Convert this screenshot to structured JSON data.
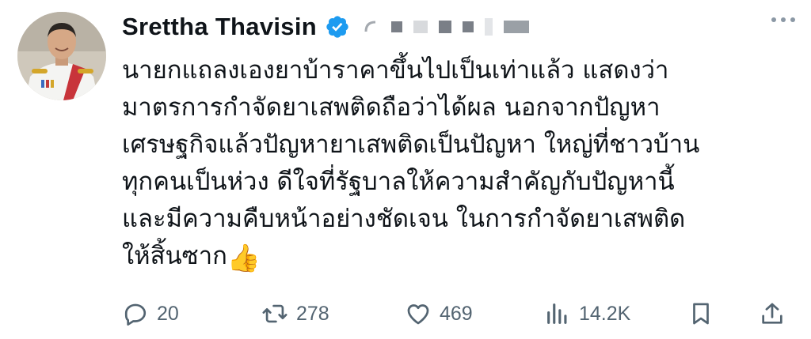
{
  "post": {
    "author_name": "Srettha Thavisin",
    "text_lines": [
      "นายกแถลงเองยาบ้าราคาขึ้นไปเป็นเท่าแล้ว แสดงว่า",
      "มาตรการกำจัดยาเสพติดถือว่าได้ผล นอกจากปัญหา",
      "เศรษฐกิจแล้วปัญหายาเสพติดเป็นปัญหา ใหญ่ที่ชาวบ้าน",
      "ทุกคนเป็นห่วง ดีใจที่รัฐบาลให้ความสำคัญกับปัญหานี้",
      "และมีความคืบหน้าอย่างชัดเจน ในการกำจัดยาเสพติด",
      "ให้สิ้นซาก"
    ],
    "emoji": "👍"
  },
  "actions": {
    "replies": "20",
    "reposts": "278",
    "likes": "469",
    "views": "14.2K"
  },
  "icons": [
    "verified-badge-icon",
    "more-icon",
    "reply-icon",
    "repost-icon",
    "like-icon",
    "views-icon",
    "bookmark-icon",
    "share-icon"
  ],
  "colors": {
    "verified": "#1d9bf0",
    "icon_gray": "#536471"
  }
}
